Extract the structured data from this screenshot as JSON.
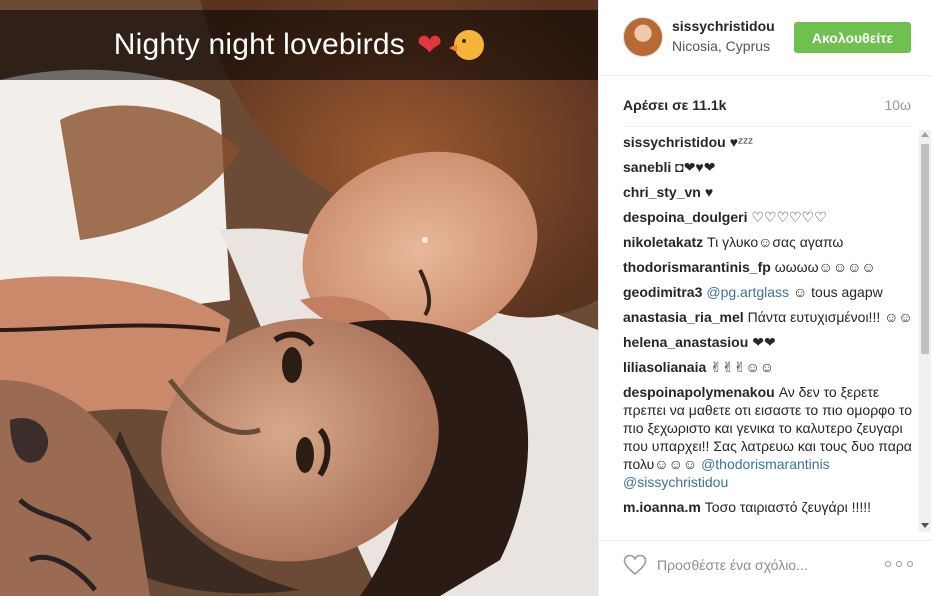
{
  "post": {
    "caption_text": "Nighty night lovebirds",
    "caption_emoji": "❤",
    "image_alt_icon": "couple-selfie-photo"
  },
  "header": {
    "username": "sissychristidou",
    "location": "Nicosia, Cyprus",
    "follow_label": "Ακολουθείτε"
  },
  "stats": {
    "likes": "Αρέσει σε 11.1k",
    "time_ago": "10ω"
  },
  "comments": [
    {
      "user": "sissychristidou",
      "text": "♥ᶻᶻᶻ"
    },
    {
      "user": "sanebli",
      "text": "◘❤♥❤"
    },
    {
      "user": "chri_sty_vn",
      "text": "♥"
    },
    {
      "user": "despoina_doulgeri",
      "text": "♡♡♡♡♡♡"
    },
    {
      "user": "nikoletakatz",
      "text": "Τι γλυκο☺σας αγαπω"
    },
    {
      "user": "thodorismarantinis_fp",
      "text": "ωωωω☺☺☺☺"
    },
    {
      "user": "geodimitra3",
      "mention": "@pg.artglass",
      "text": "☺ tous agapw"
    },
    {
      "user": "anastasia_ria_mel",
      "text": "Πάντα ευτυχισμένοι!!! ☺☺"
    },
    {
      "user": "helena_anastasiou",
      "text": "❤❤"
    },
    {
      "user": "liliasolianaia",
      "text": "✌✌✌☺☺"
    },
    {
      "user": "despoinapolymenakou",
      "text": "Αν δεν το ξερετε πρεπει να μαθετε οτι εισαστε το πιο ομορφο το πιο ξεχωριστο και γενικα το καλυτερο ζευγαρι που υπαρχει!! Σας λατρευω και τους δυο παρα πολυ☺☺☺",
      "mention": "@thodorismarantinis @sissychristidou"
    },
    {
      "user": "m.ioanna.m",
      "text": "Τοσο ταιριαστό ζευγάρι !!!!!"
    }
  ],
  "footer": {
    "comment_placeholder": "Προσθέστε ένα σχόλιο..."
  },
  "colors": {
    "follow_green": "#70c050",
    "mention_blue": "#3f729b",
    "caption_overlay": "rgba(0,0,0,0.55)"
  },
  "icons": {
    "like": "heart-icon",
    "more": "more-options-icon"
  }
}
